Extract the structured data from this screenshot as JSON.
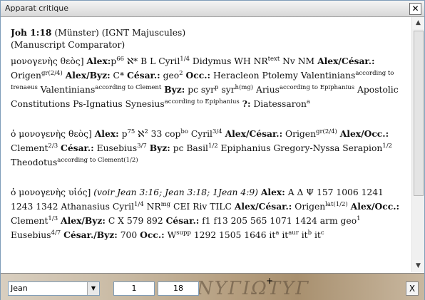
{
  "window": {
    "title": "Apparat critique",
    "close_glyph": "✕"
  },
  "entry": {
    "ref": "Joh 1:18",
    "source": "(Münster) (IGNT Majuscules)",
    "comparator": "(Manuscript Comparator)"
  },
  "para1": {
    "lemma": "μονογενὴς θεὸς]",
    "k_alex": "Alex:",
    "alex_text": "p",
    "alex_sup": "66",
    "alex_text2": " ℵ* B L Cyril",
    "alex_sup2": "1/4",
    "alex_text3": " Didymus WH NR",
    "alex_sup3": "text",
    "alex_text4": " Nv NM",
    "k_alexcesar": "Alex/César.:",
    "ac_text": " Origen",
    "ac_sup": "gr(2/4)",
    "k_alexbyz": "Alex/Byz:",
    "ab_text": " C*",
    "k_cesar": "César.:",
    "c_text": " geo",
    "c_sup": "2",
    "k_occ": "Occ.:",
    "occ_text": " Heracleon Ptolemy Valentinians",
    "occ_sup": "according to Irenaeus",
    "occ_text2": " Valentinians",
    "occ_sup2": "according to Clement",
    "k_byz": "Byz:",
    "byz_text": " pc syr",
    "byz_sup": "p",
    "byz_text2": " syr",
    "byz_sup2": "h(mg)",
    "arius_text": " Arius",
    "arius_sup": "according to Epiphanius",
    "ac2_text": " Apostolic Constitutions Ps-Ignatius Synesius",
    "ac2_sup": "according to Epiphanius",
    "k_q": "?:",
    "q_text": " Diatessaron",
    "q_sup": "a"
  },
  "para2": {
    "lemma": "ὁ μονογενὴς θεὸς]",
    "k_alex": "Alex:",
    "alex_text": " p",
    "alex_sup": "75",
    "alex_text2": " ℵ",
    "alex_sup2": "2",
    "alex_text3": " 33 cop",
    "alex_sup3": "bo",
    "alex_text4": " Cyril",
    "alex_sup4": "3/4",
    "k_alexcesar": "Alex/César.:",
    "ac_text": " Origen",
    "ac_sup": "gr(2/4)",
    "k_alexocc": "Alex/Occ.:",
    "ao_text": " Clement",
    "ao_sup": "2/3",
    "k_cesar": "César.:",
    "c_text": " Eusebius",
    "c_sup": "3/7",
    "k_byz": "Byz:",
    "byz_text": " pc Basil",
    "byz_sup": "1/2",
    "byz_text2": " Epiphanius Gregory-Nyssa Serapion",
    "byz_sup2": "1/2",
    "byz_text3": " Theodotus",
    "byz_sup3": "according to Clement(1/2)"
  },
  "para3": {
    "lemma": "ὁ μονογενὴς υἱός]",
    "voir": " (voir Jean 3:16; Jean 3:18; 1Jean 4:9)",
    "k_alex": "Alex:",
    "alex_text": " A Δ Ψ 157 1006 1241 1243 1342 Athanasius Cyril",
    "alex_sup": "1/4",
    "alex_text2": " NR",
    "alex_sup2": "mg",
    "alex_text3": " CEI Riv TILC",
    "k_alexcesar": "Alex/César.:",
    "ac_text": " Origen",
    "ac_sup": "lat(1/2)",
    "k_alexocc": "Alex/Occ.:",
    "ao_text": " Clement",
    "ao_sup": "1/3",
    "k_alexbyz": "Alex/Byz:",
    "ab_text": " C X 579 892",
    "k_cesar": "César.:",
    "c_text": " f1 f13 205 565 1071 1424 arm geo",
    "c_sup": "1",
    "c_text2": " Eusebius",
    "c_sup2": "4/7",
    "k_cesarbyz": "César./Byz:",
    "cb_text": " 700",
    "k_occ": "Occ.:",
    "occ_text": " W",
    "occ_sup": "supp",
    "occ_text2": " 1292 1505 1646 it",
    "occ_sup2": "a",
    "occ_text3": " it",
    "occ_sup3": "aur",
    "occ_text4": " it",
    "occ_sup4": "b",
    "occ_text5": " it",
    "occ_sup5": "c"
  },
  "footer": {
    "book_select": "Jean",
    "chapter": "1",
    "verse": "18",
    "plus": "+",
    "close_glyph": "X"
  }
}
